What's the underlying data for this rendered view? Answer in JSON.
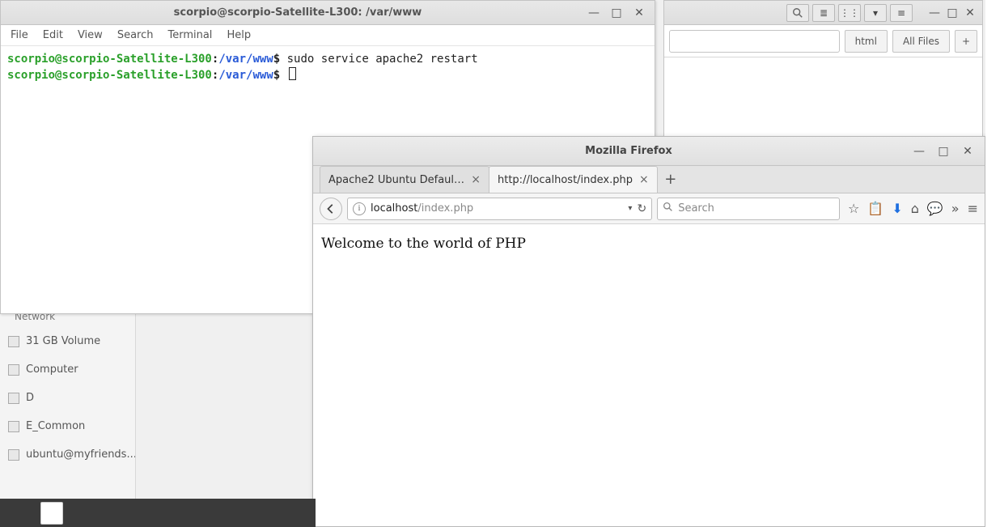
{
  "filemgr": {
    "btn_search_icon": "search-icon",
    "btn_list_icon": "list-view-icon",
    "btn_grid_icon": "grid-view-icon",
    "btn_down_icon": "dropdown-icon",
    "btn_menu_icon": "menu-icon",
    "crumb_html": "html",
    "crumb_allfiles": "All Files",
    "plus": "+"
  },
  "sidebar": {
    "network_label": "Network",
    "items": [
      "31 GB Volume",
      "Computer",
      "D",
      "E_Common",
      "ubuntu@myfriends..."
    ]
  },
  "terminal": {
    "title": "scorpio@scorpio-Satellite-L300: /var/www",
    "menu": [
      "File",
      "Edit",
      "View",
      "Search",
      "Terminal",
      "Help"
    ],
    "prompt_user": "scorpio@scorpio-Satellite-L300",
    "prompt_path": "/var/www",
    "dollar": "$",
    "command1": "sudo service apache2 restart"
  },
  "firefox": {
    "title": "Mozilla Firefox",
    "tabs": [
      {
        "label": "Apache2 Ubuntu Default ..."
      },
      {
        "label": "http://localhost/index.php"
      }
    ],
    "url_host": "localhost",
    "url_path": "/index.php",
    "search_placeholder": "Search",
    "page_text": "Welcome to the world of PHP"
  },
  "winctrl": {
    "min": "—",
    "max": "□",
    "close": "✕"
  }
}
